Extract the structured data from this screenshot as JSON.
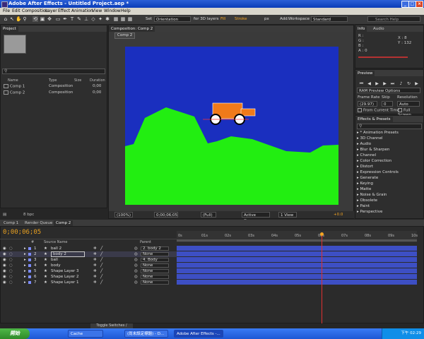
{
  "window": {
    "title": "Adobe After Effects - Untitled Project.aep *"
  },
  "menu": [
    "File",
    "Edit",
    "Composition",
    "Layer",
    "Effect",
    "Animation",
    "View",
    "Window",
    "Help"
  ],
  "toolbar": {
    "set_label": "Set",
    "orientation_value": "Orientation",
    "layers_label": "for 3D layers",
    "fill_label": "Fill",
    "stroke_label": "Stroke",
    "px_label": "px",
    "add_label": "Add:",
    "workspace_label": "Workspace",
    "workspace_value": "Standard",
    "search_placeholder": "Search Help"
  },
  "project": {
    "tab": "Project",
    "search_placeholder": "",
    "columns": [
      "Name",
      "Type",
      "Size",
      "Duration"
    ],
    "items": [
      {
        "name": "Comp 1",
        "type": "Composition",
        "duration": "0;00"
      },
      {
        "name": "Comp 2",
        "type": "Composition",
        "duration": "0;00"
      }
    ],
    "footer_bpc": "8 bpc"
  },
  "composition": {
    "tab": "Composition: Comp 2",
    "subtab": "Comp 2",
    "zoom": "(100%)",
    "timecode": "0;00;06;05",
    "resolution": "(Full)",
    "camera": "Active Camera",
    "view": "1 View",
    "exposure": "+0.0",
    "colors": {
      "sky": "#1a2fbf",
      "ground": "#22ee11",
      "car": "#f07a1a"
    }
  },
  "info": {
    "tabs": [
      "Info",
      "Audio"
    ],
    "r": "R :",
    "g": "G :",
    "b": "B :",
    "a": "A : 0",
    "x": "X : 8",
    "y": "Y : 132"
  },
  "preview": {
    "tab": "Preview",
    "options": "RAM Preview Options",
    "frame_rate_label": "Frame Rate",
    "skip_label": "Skip",
    "resolution_label": "Resolution",
    "frame_rate": "(29.97)",
    "skip": "0",
    "resolution": "Auto",
    "from_current": "From Current Time",
    "full_screen": "Full Screen"
  },
  "effects": {
    "tab": "Effects & Presets",
    "search_placeholder": "",
    "items": [
      "* Animation Presets",
      "3D Channel",
      "Audio",
      "Blur & Sharpen",
      "Channel",
      "Color Correction",
      "Distort",
      "Expression Controls",
      "Generate",
      "Keying",
      "Matte",
      "Noise & Grain",
      "Obsolete",
      "Paint",
      "Perspective"
    ]
  },
  "bottom_tabs": [
    "Comp 1",
    "Render Queue",
    "Comp 2"
  ],
  "timeline": {
    "timecode": "0;00;06;05",
    "columns": [
      "#",
      "Source Name",
      "Parent"
    ],
    "layers": [
      {
        "num": "1",
        "name": "ball 2",
        "parent": "2. body 2"
      },
      {
        "num": "2",
        "name": "body 2",
        "parent": "None"
      },
      {
        "num": "3",
        "name": "ball",
        "parent": "4. Body"
      },
      {
        "num": "4",
        "name": "body",
        "parent": "None"
      },
      {
        "num": "5",
        "name": "Shape Layer 3",
        "parent": "None"
      },
      {
        "num": "6",
        "name": "Shape Layer 2",
        "parent": "None"
      },
      {
        "num": "7",
        "name": "Shape Layer 1",
        "parent": "None"
      }
    ],
    "ticks": [
      "0s",
      "01s",
      "02s",
      "03s",
      "04s",
      "05s",
      "06s",
      "07s",
      "08s",
      "09s",
      "10s"
    ],
    "current_time_fraction": 0.62,
    "toggle_label": "Toggle Switches / Modes"
  },
  "taskbar": {
    "start": "開始",
    "items": [
      "Cache",
      "(尚未設定標題) - D...",
      "Adobe After Effects -..."
    ],
    "clock": "下午 02:29"
  }
}
